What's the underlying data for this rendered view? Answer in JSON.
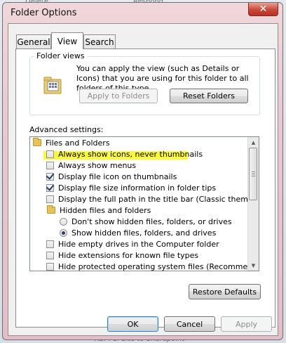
{
  "background": {
    "snippets": [
      "Delete",
      "Respond",
      "RE: PCI Site to Sharepoint"
    ]
  },
  "window": {
    "title": "Folder Options",
    "close_glyph": "✕"
  },
  "tabs": [
    {
      "label": "General"
    },
    {
      "label": "View"
    },
    {
      "label": "Search"
    }
  ],
  "folder_views": {
    "legend": "Folder views",
    "description": "You can apply the view (such as Details or Icons) that you are using for this folder to all folders of this type.",
    "apply_button": "Apply to Folders",
    "reset_button": "Reset Folders"
  },
  "advanced": {
    "label": "Advanced settings:",
    "items": [
      {
        "type": "folder",
        "label": "Files and Folders"
      },
      {
        "type": "checkbox",
        "checked": false,
        "label": "Always show icons, never thumbnails",
        "highlighted": true
      },
      {
        "type": "checkbox",
        "checked": false,
        "label": "Always show menus"
      },
      {
        "type": "checkbox",
        "checked": true,
        "label": "Display file icon on thumbnails"
      },
      {
        "type": "checkbox",
        "checked": true,
        "label": "Display file size information in folder tips"
      },
      {
        "type": "checkbox",
        "checked": false,
        "label": "Display the full path in the title bar (Classic theme only)"
      },
      {
        "type": "folder",
        "label": "Hidden files and folders",
        "indent": 1
      },
      {
        "type": "radio",
        "checked": false,
        "label": "Don't show hidden files, folders, or drives",
        "indent": 2
      },
      {
        "type": "radio",
        "checked": true,
        "label": "Show hidden files, folders, and drives",
        "indent": 2
      },
      {
        "type": "checkbox",
        "checked": false,
        "label": "Hide empty drives in the Computer folder"
      },
      {
        "type": "checkbox",
        "checked": false,
        "label": "Hide extensions for known file types"
      },
      {
        "type": "checkbox",
        "checked": false,
        "label": "Hide protected operating system files (Recommended)"
      }
    ],
    "restore_button": "Restore Defaults"
  },
  "footer": {
    "ok": "OK",
    "cancel": "Cancel",
    "apply": "Apply"
  },
  "colors": {
    "highlight": "#fbf93c",
    "close": "#c9483a"
  }
}
